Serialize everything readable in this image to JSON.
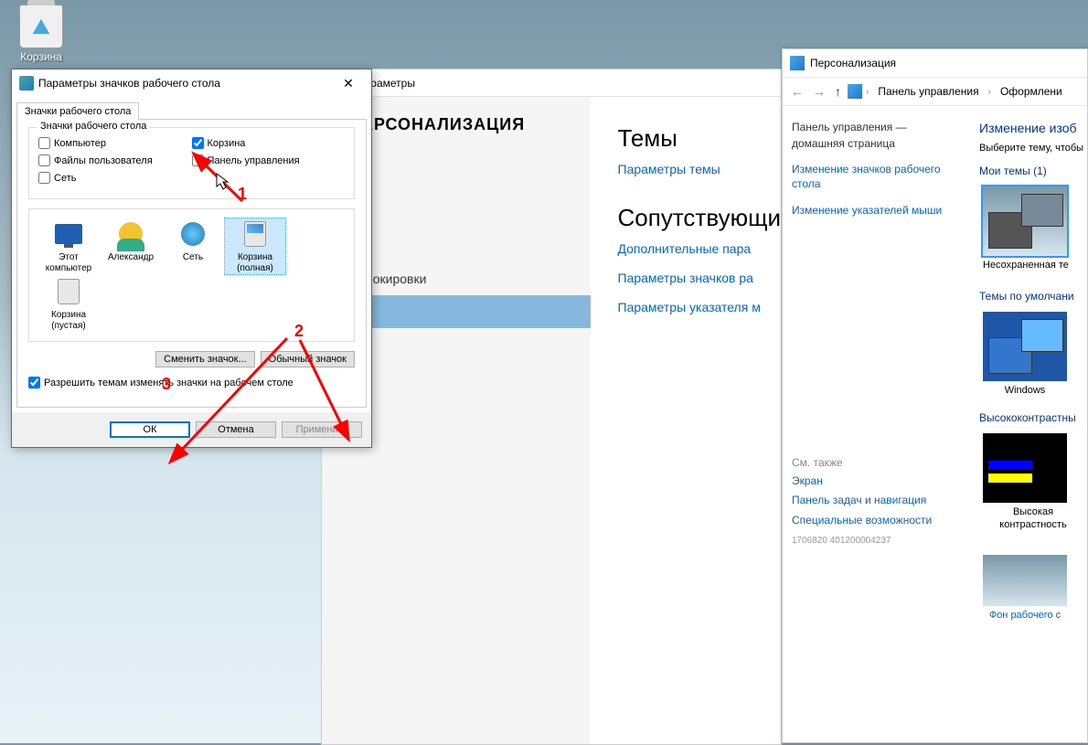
{
  "desktop": {
    "recycle_bin_label": "Корзина"
  },
  "settings": {
    "title": "Параметры",
    "header": "ПЕРСОНАЛИЗАЦИЯ",
    "nav_lockscreen": "блокировки",
    "themes_heading": "Темы",
    "themes_params": "Параметры темы",
    "related_heading": "Сопутствующи",
    "related_1": "Дополнительные пара",
    "related_2": "Параметры значков ра",
    "related_3": "Параметры указателя м"
  },
  "dialog": {
    "title": "Параметры значков рабочего стола",
    "tab": "Значки рабочего стола",
    "group_title": "Значки рабочего стола",
    "chk_computer": "Компьютер",
    "chk_recycle": "Корзина",
    "chk_userfiles": "Файлы пользователя",
    "chk_controlpanel": "Панель управления",
    "chk_network": "Сеть",
    "icons": {
      "thispc_1": "Этот",
      "thispc_2": "компьютер",
      "user": "Александр",
      "network": "Сеть",
      "bin_full_1": "Корзина",
      "bin_full_2": "(полная)",
      "bin_empty_1": "Корзина",
      "bin_empty_2": "(пустая)"
    },
    "btn_change": "Сменить значок...",
    "btn_default": "Обычный значок",
    "chk_allow": "Разрешить темам изменять значки на рабочем столе",
    "btn_ok": "ОК",
    "btn_cancel": "Отмена",
    "btn_apply": "Применить"
  },
  "cp": {
    "title": "Персонализация",
    "crumb1": "Панель управления",
    "crumb2": "Оформлени",
    "home1": "Панель управления —",
    "home2": "домашняя страница",
    "link1": "Изменение значков рабочего стола",
    "link2": "Изменение указателей мыши",
    "see_also": "См. также",
    "link_screen": "Экран",
    "link_taskbar": "Панель задач и навигация",
    "link_accessibility": "Специальные возможности",
    "main_heading": "Изменение изоб",
    "main_hint": "Выберите тему, чтобы",
    "cat_my": "Мои темы (1)",
    "theme_unsaved": "Несохраненная те",
    "cat_default": "Темы по умолчани",
    "theme_windows": "Windows",
    "theme_hc_label": "Высококонтрастны",
    "theme_hc": "Высокая контрастность",
    "desktop_bg": "Фон рабочего с",
    "img_id": "1706820 401200004237"
  },
  "annotations": {
    "n1": "1",
    "n2": "2",
    "n3": "3"
  }
}
